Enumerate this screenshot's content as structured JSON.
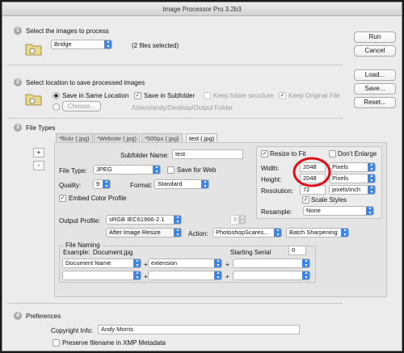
{
  "window": {
    "title": "Image Processor Pro 3.2b3"
  },
  "section1": {
    "num": "1",
    "title": "Select the images to process",
    "source": "Bridge",
    "count": "(2 files selected)"
  },
  "section2": {
    "num": "2",
    "title": "Select location to save processed images",
    "save_same": "Save in Same Location",
    "save_sub": "Save in Subfolder",
    "keep_folder": "Keep folder structure",
    "keep_original": "Keep Original File",
    "choose": "Choose...",
    "path": "/Users/andy/Desktop/Output Folder"
  },
  "section3": {
    "num": "3",
    "title": "File Types",
    "add": "+",
    "remove": "-",
    "tabs": [
      "*flickr (.jpg)",
      "*Website (.jpg)",
      "*500px (.jpg)",
      "test (.jpg)"
    ],
    "subfolder_label": "Subfolder Name:",
    "subfolder_value": "test",
    "file_type_label": "File Type:",
    "file_type": "JPEG",
    "save_for_web": "Save for Web",
    "quality_label": "Quality:",
    "quality": "9",
    "format_label": "Format:",
    "format": "Standard",
    "embed_profile": "Embed Color Profile",
    "output_profile_label": "Output Profile:",
    "output_profile": "sRGB IEC61966-2.1",
    "bit_depth": "8",
    "after_label": "After Image Resize",
    "action_label": "Action:",
    "action_set": "PhotoshopScares...",
    "action": "Batch Sharpening",
    "resize": {
      "resize_to_fit": "Resize to Fit",
      "dont_enlarge": "Don't Enlarge",
      "width_label": "Width:",
      "width": "2048",
      "width_unit": "Pixels",
      "height_label": "Height:",
      "height": "2048",
      "height_unit": "Pixels",
      "resolution_label": "Resolution:",
      "resolution": "72",
      "resolution_unit": "pixels/inch",
      "scale_styles": "Scale Styles",
      "resample_label": "Resample:",
      "resample": "None"
    },
    "naming": {
      "title": "File Naming",
      "example_label": "Example:",
      "example": "Document.jpg",
      "serial_label": "Starting Serial",
      "serial": "0",
      "field1": "Document Name",
      "field2": "extension",
      "plus": "+"
    }
  },
  "section4": {
    "num": "4",
    "title": "Preferences",
    "copyright_label": "Copyright Info:",
    "copyright": "Andy Morris",
    "preserve": "Preserve filename in XMP Metadata"
  },
  "buttons": {
    "run": "Run",
    "cancel": "Cancel",
    "load": "Load...",
    "save": "Save...",
    "reset": "Reset..."
  },
  "colors": {
    "accent": "#3b84e8",
    "highlight": "#e0101a"
  },
  "icons": {
    "folder": "folder-icon",
    "chevron": "chevron-updown-icon"
  }
}
